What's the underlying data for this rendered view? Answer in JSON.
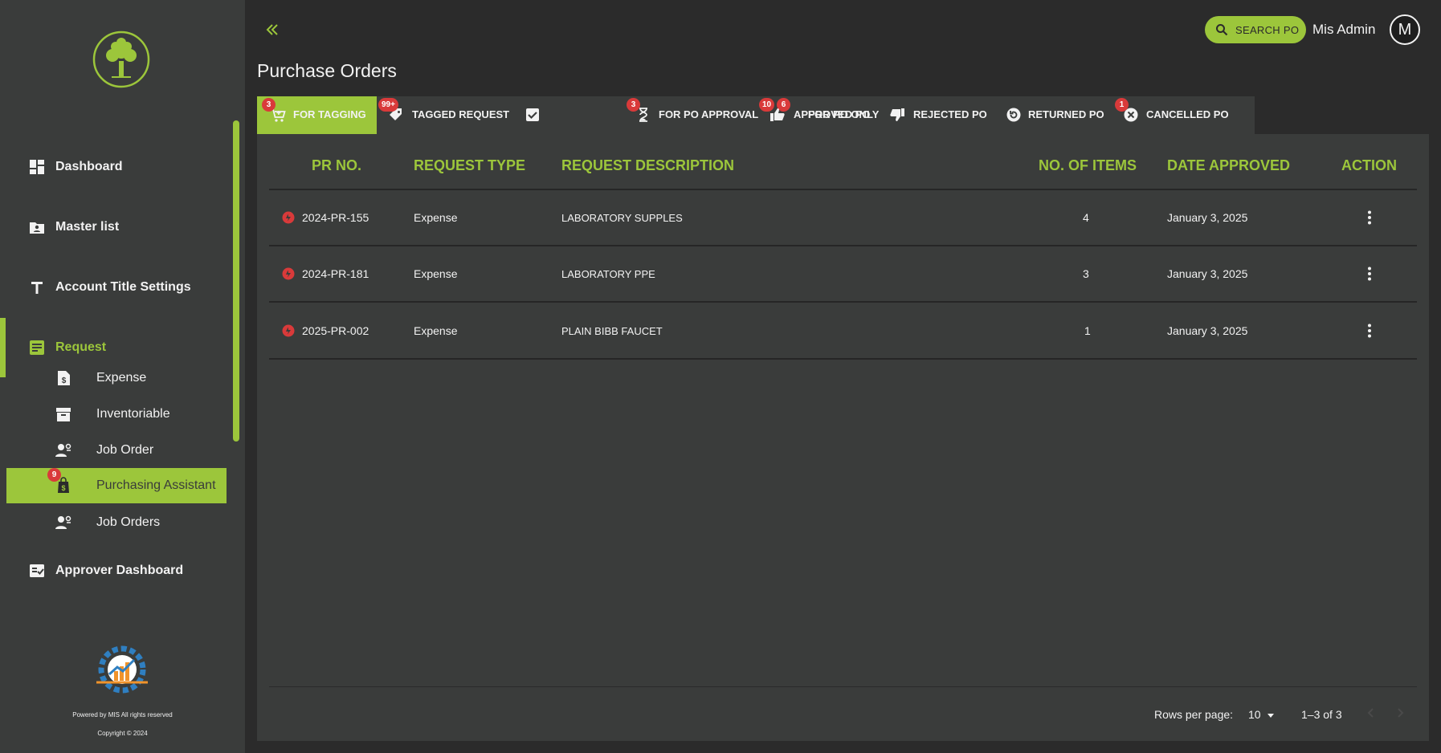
{
  "sidebar": {
    "nav": [
      {
        "label": "Dashboard",
        "icon": "dashboard-icon"
      },
      {
        "label": "Master list",
        "icon": "master-list-icon"
      },
      {
        "label": "Account Title Settings",
        "icon": "text-icon"
      },
      {
        "label": "Request",
        "icon": "request-icon"
      },
      {
        "label": "Approver Dashboard",
        "icon": "approver-icon"
      }
    ],
    "sub_items": [
      {
        "label": "Expense",
        "icon": "expense-icon"
      },
      {
        "label": "Inventoriable",
        "icon": "archive-icon"
      },
      {
        "label": "Job Order",
        "icon": "job-order-icon"
      },
      {
        "label": "Purchasing Assistant",
        "icon": "purchasing-icon",
        "badge": "9"
      },
      {
        "label": "Job Orders",
        "icon": "job-orders-icon"
      }
    ],
    "footer": {
      "powered": "Powered by MIS All rights reserved",
      "copyright": "Copyright © 2024"
    }
  },
  "header": {
    "search_label": "SEARCH PO",
    "user_name": "Mis Admin",
    "avatar_initial": "M"
  },
  "page_title": "Purchase Orders",
  "tabs": [
    {
      "label": "FOR TAGGING",
      "badge": "3",
      "icon": "cart-icon",
      "active": true
    },
    {
      "label": "TAGGED REQUEST",
      "badge": "99+",
      "icon": "tag-icon"
    },
    {
      "label": "FOR PO ONLY",
      "badge": "6",
      "icon": "check-box-icon"
    },
    {
      "label": "FOR PO APPROVAL",
      "badge": "3",
      "icon": "hourglass-icon"
    },
    {
      "label": "APPROVED PO",
      "badge": "10",
      "icon": "thumbs-up-icon"
    },
    {
      "label": "REJECTED PO",
      "icon": "thumbs-down-icon"
    },
    {
      "label": "RETURNED PO",
      "icon": "return-icon"
    },
    {
      "label": "CANCELLED PO",
      "badge": "1",
      "icon": "cancel-icon"
    }
  ],
  "table": {
    "columns": [
      "PR NO.",
      "REQUEST TYPE",
      "REQUEST DESCRIPTION",
      "NO. OF ITEMS",
      "DATE APPROVED",
      "ACTION"
    ],
    "rows": [
      {
        "pr_no": "2024-PR-155",
        "type": "Expense",
        "description": "LABORATORY SUPPLES",
        "items": "4",
        "date": "January 3, 2025"
      },
      {
        "pr_no": "2024-PR-181",
        "type": "Expense",
        "description": "LABORATORY PPE",
        "items": "3",
        "date": "January 3, 2025"
      },
      {
        "pr_no": "2025-PR-002",
        "type": "Expense",
        "description": "PLAIN BIBB FAUCET",
        "items": "1",
        "date": "January 3, 2025"
      }
    ]
  },
  "pagination": {
    "rows_per_page_label": "Rows per page:",
    "rows_per_page": "10",
    "range": "1–3 of 3"
  },
  "colors": {
    "accent": "#9cc63b",
    "background": "#2b2b2b",
    "panel": "#3a3c3b",
    "badge": "#d93a3a"
  }
}
